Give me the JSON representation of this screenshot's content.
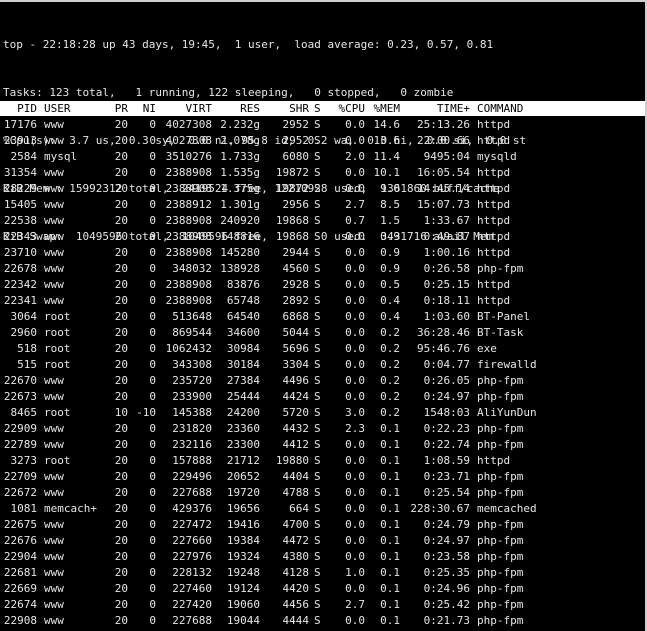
{
  "summary": {
    "lines": [
      "top - 22:18:28 up 43 days, 19:45,  1 user,  load average: 0.23, 0.57, 0.81",
      "Tasks: 123 total,   1 running, 122 sleeping,   0 stopped,   0 zombie",
      "%Cpu(s):  3.7 us,  0.3 sy,  0.0 ni, 95.8 id,  0.2 wa,  0.0 hi,  0.0 si,  0.0 st",
      "KiB Mem : 15992312 total,  2419524 free, 12210928 used,  1361860 buff/cache",
      "KiB Swap:  1049596 total,  1049596 free,        0 used.  3431716 avail Mem"
    ]
  },
  "table": {
    "columns": {
      "pid": "PID",
      "user": "USER",
      "pr": "PR",
      "ni": "NI",
      "virt": "VIRT",
      "res": "RES",
      "shr": "SHR",
      "s": "S",
      "cpu": "%CPU",
      "mem": "%MEM",
      "time": "TIME+",
      "command": "COMMAND"
    },
    "rows": [
      {
        "pid": "17176",
        "user": "www",
        "pr": "20",
        "ni": "0",
        "virt": "4027308",
        "res": "2.232g",
        "shr": "2952",
        "s": "S",
        "cpu": "0.0",
        "mem": "14.6",
        "time": "25:13.26",
        "command": "httpd"
      },
      {
        "pid": "23913",
        "user": "www",
        "pr": "20",
        "ni": "0",
        "virt": "4027308",
        "res": "2.078g",
        "shr": "2952",
        "s": "S",
        "cpu": "0.0",
        "mem": "13.6",
        "time": "22:00.66",
        "command": "httpd"
      },
      {
        "pid": "2584",
        "user": "mysql",
        "pr": "20",
        "ni": "0",
        "virt": "3510276",
        "res": "1.733g",
        "shr": "6080",
        "s": "S",
        "cpu": "2.0",
        "mem": "11.4",
        "time": "9495:04",
        "command": "mysqld"
      },
      {
        "pid": "31354",
        "user": "www",
        "pr": "20",
        "ni": "0",
        "virt": "2388908",
        "res": "1.535g",
        "shr": "19872",
        "s": "S",
        "cpu": "0.0",
        "mem": "10.1",
        "time": "16:05.54",
        "command": "httpd"
      },
      {
        "pid": "28229",
        "user": "www",
        "pr": "20",
        "ni": "0",
        "virt": "2388908",
        "res": "1.375g",
        "shr": "19872",
        "s": "S",
        "cpu": "0.0",
        "mem": "9.0",
        "time": "14:45.14",
        "command": "httpd"
      },
      {
        "pid": "15405",
        "user": "www",
        "pr": "20",
        "ni": "0",
        "virt": "2388912",
        "res": "1.301g",
        "shr": "2956",
        "s": "S",
        "cpu": "2.7",
        "mem": "8.5",
        "time": "15:07.73",
        "command": "httpd"
      },
      {
        "pid": "22538",
        "user": "www",
        "pr": "20",
        "ni": "0",
        "virt": "2388908",
        "res": "240920",
        "shr": "19868",
        "s": "S",
        "cpu": "0.7",
        "mem": "1.5",
        "time": "1:33.67",
        "command": "httpd"
      },
      {
        "pid": "22343",
        "user": "www",
        "pr": "20",
        "ni": "0",
        "virt": "2388908",
        "res": "148816",
        "shr": "19868",
        "s": "S",
        "cpu": "0.0",
        "mem": "0.9",
        "time": "0:49.87",
        "command": "httpd"
      },
      {
        "pid": "23710",
        "user": "www",
        "pr": "20",
        "ni": "0",
        "virt": "2388908",
        "res": "145280",
        "shr": "2944",
        "s": "S",
        "cpu": "0.0",
        "mem": "0.9",
        "time": "1:00.16",
        "command": "httpd"
      },
      {
        "pid": "22678",
        "user": "www",
        "pr": "20",
        "ni": "0",
        "virt": "348032",
        "res": "138928",
        "shr": "4560",
        "s": "S",
        "cpu": "0.0",
        "mem": "0.9",
        "time": "0:26.58",
        "command": "php-fpm"
      },
      {
        "pid": "22342",
        "user": "www",
        "pr": "20",
        "ni": "0",
        "virt": "2388908",
        "res": "83876",
        "shr": "2928",
        "s": "S",
        "cpu": "0.0",
        "mem": "0.5",
        "time": "0:25.15",
        "command": "httpd"
      },
      {
        "pid": "22341",
        "user": "www",
        "pr": "20",
        "ni": "0",
        "virt": "2388908",
        "res": "65748",
        "shr": "2892",
        "s": "S",
        "cpu": "0.0",
        "mem": "0.4",
        "time": "0:18.11",
        "command": "httpd"
      },
      {
        "pid": "3064",
        "user": "root",
        "pr": "20",
        "ni": "0",
        "virt": "513648",
        "res": "64540",
        "shr": "6868",
        "s": "S",
        "cpu": "0.0",
        "mem": "0.4",
        "time": "1:03.60",
        "command": "BT-Panel"
      },
      {
        "pid": "2960",
        "user": "root",
        "pr": "20",
        "ni": "0",
        "virt": "869544",
        "res": "34600",
        "shr": "5044",
        "s": "S",
        "cpu": "0.0",
        "mem": "0.2",
        "time": "36:28.46",
        "command": "BT-Task"
      },
      {
        "pid": "518",
        "user": "root",
        "pr": "20",
        "ni": "0",
        "virt": "1062432",
        "res": "30984",
        "shr": "5696",
        "s": "S",
        "cpu": "0.0",
        "mem": "0.2",
        "time": "95:46.76",
        "command": "exe"
      },
      {
        "pid": "515",
        "user": "root",
        "pr": "20",
        "ni": "0",
        "virt": "343308",
        "res": "30184",
        "shr": "3304",
        "s": "S",
        "cpu": "0.0",
        "mem": "0.2",
        "time": "0:04.77",
        "command": "firewalld"
      },
      {
        "pid": "22670",
        "user": "www",
        "pr": "20",
        "ni": "0",
        "virt": "235720",
        "res": "27384",
        "shr": "4496",
        "s": "S",
        "cpu": "0.0",
        "mem": "0.2",
        "time": "0:26.05",
        "command": "php-fpm"
      },
      {
        "pid": "22673",
        "user": "www",
        "pr": "20",
        "ni": "0",
        "virt": "233900",
        "res": "25444",
        "shr": "4424",
        "s": "S",
        "cpu": "0.0",
        "mem": "0.2",
        "time": "0:24.97",
        "command": "php-fpm"
      },
      {
        "pid": "8465",
        "user": "root",
        "pr": "10",
        "ni": "-10",
        "virt": "145388",
        "res": "24200",
        "shr": "5720",
        "s": "S",
        "cpu": "3.0",
        "mem": "0.2",
        "time": "1548:03",
        "command": "AliYunDun"
      },
      {
        "pid": "22909",
        "user": "www",
        "pr": "20",
        "ni": "0",
        "virt": "231820",
        "res": "23360",
        "shr": "4432",
        "s": "S",
        "cpu": "2.3",
        "mem": "0.1",
        "time": "0:22.23",
        "command": "php-fpm"
      },
      {
        "pid": "22789",
        "user": "www",
        "pr": "20",
        "ni": "0",
        "virt": "232116",
        "res": "23300",
        "shr": "4412",
        "s": "S",
        "cpu": "0.0",
        "mem": "0.1",
        "time": "0:22.74",
        "command": "php-fpm"
      },
      {
        "pid": "3273",
        "user": "root",
        "pr": "20",
        "ni": "0",
        "virt": "157888",
        "res": "21712",
        "shr": "19880",
        "s": "S",
        "cpu": "0.0",
        "mem": "0.1",
        "time": "1:08.59",
        "command": "httpd"
      },
      {
        "pid": "22709",
        "user": "www",
        "pr": "20",
        "ni": "0",
        "virt": "229496",
        "res": "20652",
        "shr": "4404",
        "s": "S",
        "cpu": "0.0",
        "mem": "0.1",
        "time": "0:23.71",
        "command": "php-fpm"
      },
      {
        "pid": "22672",
        "user": "www",
        "pr": "20",
        "ni": "0",
        "virt": "227688",
        "res": "19720",
        "shr": "4788",
        "s": "S",
        "cpu": "0.0",
        "mem": "0.1",
        "time": "0:25.54",
        "command": "php-fpm"
      },
      {
        "pid": "1081",
        "user": "memcach+",
        "pr": "20",
        "ni": "0",
        "virt": "429376",
        "res": "19656",
        "shr": "664",
        "s": "S",
        "cpu": "0.0",
        "mem": "0.1",
        "time": "228:30.67",
        "command": "memcached"
      },
      {
        "pid": "22675",
        "user": "www",
        "pr": "20",
        "ni": "0",
        "virt": "227472",
        "res": "19416",
        "shr": "4700",
        "s": "S",
        "cpu": "0.0",
        "mem": "0.1",
        "time": "0:24.79",
        "command": "php-fpm"
      },
      {
        "pid": "22676",
        "user": "www",
        "pr": "20",
        "ni": "0",
        "virt": "227660",
        "res": "19384",
        "shr": "4472",
        "s": "S",
        "cpu": "0.0",
        "mem": "0.1",
        "time": "0:24.97",
        "command": "php-fpm"
      },
      {
        "pid": "22904",
        "user": "www",
        "pr": "20",
        "ni": "0",
        "virt": "227976",
        "res": "19324",
        "shr": "4380",
        "s": "S",
        "cpu": "0.0",
        "mem": "0.1",
        "time": "0:23.58",
        "command": "php-fpm"
      },
      {
        "pid": "22681",
        "user": "www",
        "pr": "20",
        "ni": "0",
        "virt": "228132",
        "res": "19248",
        "shr": "4128",
        "s": "S",
        "cpu": "1.0",
        "mem": "0.1",
        "time": "0:25.35",
        "command": "php-fpm"
      },
      {
        "pid": "22669",
        "user": "www",
        "pr": "20",
        "ni": "0",
        "virt": "227460",
        "res": "19124",
        "shr": "4420",
        "s": "S",
        "cpu": "0.0",
        "mem": "0.1",
        "time": "0:24.96",
        "command": "php-fpm"
      },
      {
        "pid": "22674",
        "user": "www",
        "pr": "20",
        "ni": "0",
        "virt": "227420",
        "res": "19060",
        "shr": "4456",
        "s": "S",
        "cpu": "2.7",
        "mem": "0.1",
        "time": "0:25.42",
        "command": "php-fpm"
      },
      {
        "pid": "22908",
        "user": "www",
        "pr": "20",
        "ni": "0",
        "virt": "227688",
        "res": "19044",
        "shr": "4444",
        "s": "S",
        "cpu": "0.0",
        "mem": "0.1",
        "time": "0:21.73",
        "command": "php-fpm"
      }
    ]
  }
}
